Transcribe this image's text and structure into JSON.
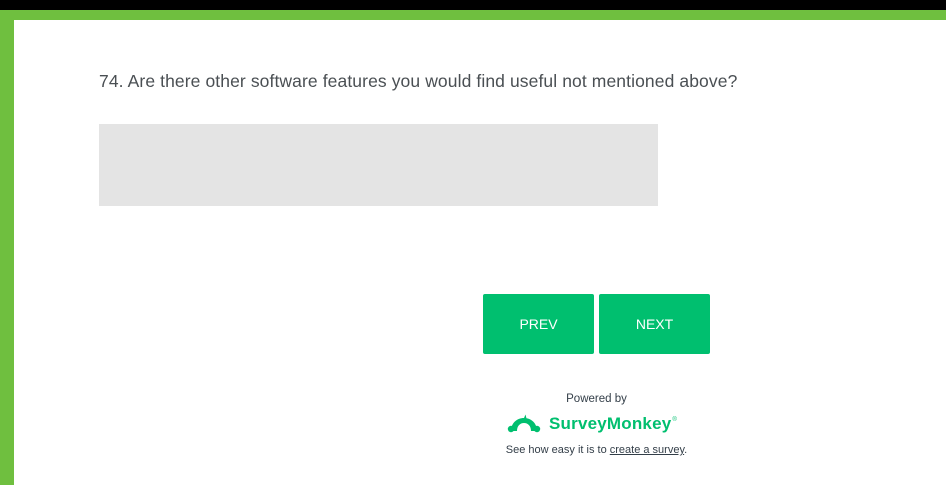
{
  "question": {
    "text": "74. Are there other software features you would find useful not mentioned above?",
    "answer_value": ""
  },
  "buttons": {
    "prev_label": "PREV",
    "next_label": "NEXT"
  },
  "footer": {
    "powered_by": "Powered by",
    "brand_name": "SurveyMonkey",
    "brand_tm": "®",
    "tagline_prefix": "See how easy it is to ",
    "tagline_link": "create a survey",
    "tagline_suffix": "."
  },
  "colors": {
    "accent": "#00bf6f",
    "frame": "#6fbf3f",
    "input_bg": "#e4e4e4"
  },
  "icons": {
    "brand_logo": "surveymonkey-logo-icon"
  }
}
